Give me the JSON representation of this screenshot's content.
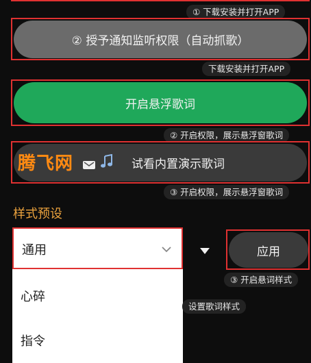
{
  "step1": {
    "chip": "① 下载安装并打开APP"
  },
  "step2": {
    "button": "② 授予通知监听权限（自动抓歌）",
    "chip": "下载安装并打开APP"
  },
  "step3": {
    "button": "开启悬浮歌词",
    "chip": "② 开启权限，展示悬浮窗歌词"
  },
  "step4": {
    "logo": "腾飞网",
    "button": "试看内置演示歌词",
    "chip": "③ 开启权限，展示悬浮窗歌词"
  },
  "style_preset": {
    "title": "样式预设",
    "selected": "通用",
    "options": [
      "心碎",
      "指令"
    ],
    "apply_label": "应用",
    "apply_chip": "③ 开启悬词样式",
    "set_chip": "设置歌词样式"
  },
  "colors": {
    "accent_green": "#1fa85a",
    "highlight_red": "#e03131",
    "title_orange": "#e9a13d",
    "logo_orange": "#ff8a12"
  }
}
